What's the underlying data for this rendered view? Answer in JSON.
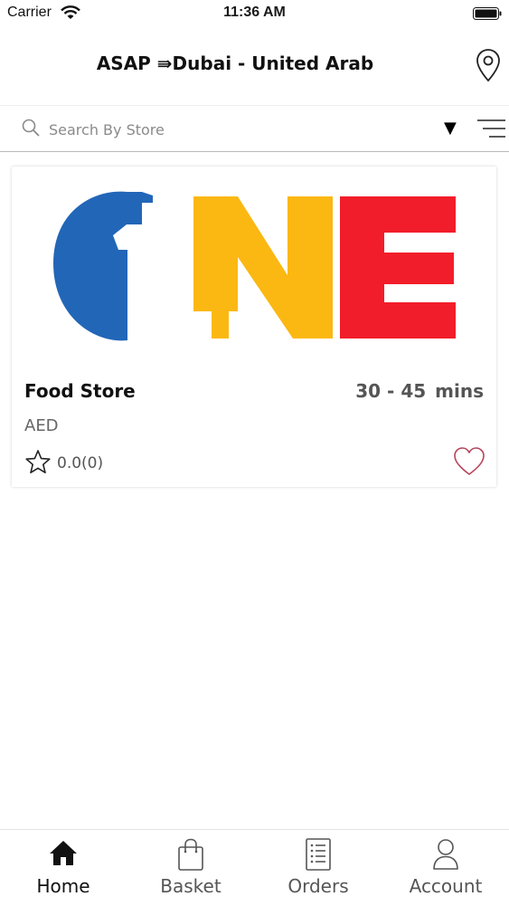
{
  "status_bar": {
    "carrier": "Carrier",
    "time": "11:36 AM"
  },
  "header": {
    "title": "ASAP ⇛Dubai - United Arab"
  },
  "search": {
    "placeholder": "Search By Store",
    "dropdown_glyph": "▼"
  },
  "stores": [
    {
      "name": "Food Store",
      "delivery_time": "30 - 45",
      "delivery_unit": "mins",
      "currency": "AED",
      "rating": "0.0(0)",
      "logo_text": "ONE"
    }
  ],
  "tabs": [
    {
      "label": "Home",
      "icon": "home-icon",
      "active": true
    },
    {
      "label": "Basket",
      "icon": "basket-icon",
      "active": false
    },
    {
      "label": "Orders",
      "icon": "orders-icon",
      "active": false
    },
    {
      "label": "Account",
      "icon": "account-icon",
      "active": false
    }
  ],
  "colors": {
    "logo_blue": "#2266b8",
    "logo_yellow": "#fbb812",
    "logo_red": "#f21d2a",
    "heart": "#b6455b"
  }
}
